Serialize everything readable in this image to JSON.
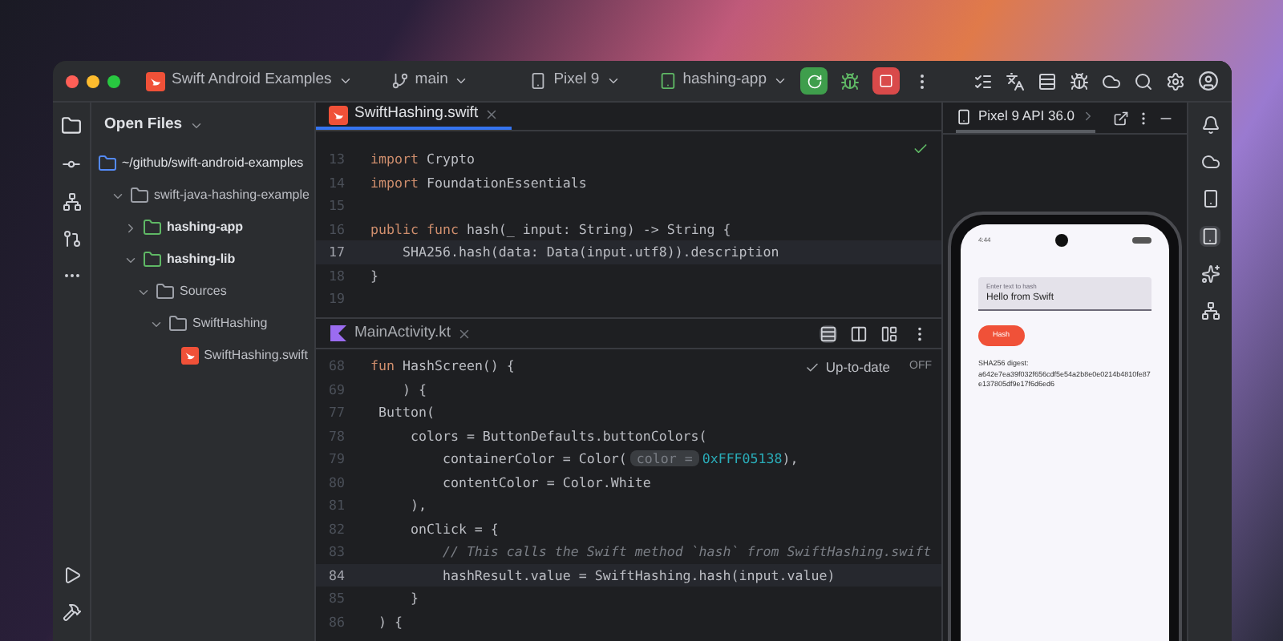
{
  "title_bar": {
    "project": "Swift Android Examples",
    "branch": "main",
    "device": "Pixel 9",
    "run_config": "hashing-app"
  },
  "project_panel": {
    "title": "Open Files",
    "tree": [
      {
        "label": "~/github/swift-android-examples",
        "kind": "root",
        "children": [
          {
            "label": "swift-java-hashing-example",
            "kind": "folder",
            "expanded": true,
            "children": [
              {
                "label": "hashing-app",
                "kind": "module",
                "expanded": false
              },
              {
                "label": "hashing-lib",
                "kind": "module",
                "expanded": true,
                "children": [
                  {
                    "label": "Sources",
                    "kind": "folder",
                    "expanded": true,
                    "children": [
                      {
                        "label": "SwiftHashing",
                        "kind": "folder",
                        "expanded": true,
                        "children": [
                          {
                            "label": "SwiftHashing.swift",
                            "kind": "swift"
                          }
                        ]
                      }
                    ]
                  }
                ]
              }
            ]
          }
        ]
      }
    ]
  },
  "editor_top": {
    "tabs": [
      {
        "label": "SwiftHashing.swift",
        "kind": "swift",
        "selected": true
      }
    ],
    "lines": [
      {
        "number": "13",
        "highlighted": false,
        "segments": [
          {
            "kind": "keyword",
            "text": "import "
          },
          {
            "kind": "plain",
            "text": "Crypto"
          }
        ]
      },
      {
        "number": "14",
        "highlighted": false,
        "segments": [
          {
            "kind": "keyword",
            "text": "import "
          },
          {
            "kind": "plain",
            "text": "FoundationEssentials"
          }
        ]
      },
      {
        "number": "15",
        "highlighted": false
      },
      {
        "number": "16",
        "highlighted": false,
        "segments": [
          {
            "kind": "keyword",
            "text": "public func "
          },
          {
            "kind": "plain",
            "text": "hash(_ input: String) -> String {"
          }
        ]
      },
      {
        "number": "17",
        "highlighted": true,
        "segments": [
          {
            "kind": "plain",
            "text": "    SHA256.hash(data: Data(input.utf8)).description"
          }
        ]
      },
      {
        "number": "18",
        "highlighted": false,
        "segments": [
          {
            "kind": "plain",
            "text": "}"
          }
        ]
      },
      {
        "number": "19",
        "highlighted": false
      }
    ]
  },
  "editor_bottom": {
    "tabs": [
      {
        "label": "MainActivity.kt",
        "kind": "kotlin",
        "selected": false
      }
    ],
    "status": "Up-to-date",
    "toggle": "OFF",
    "lines": [
      {
        "number": "68",
        "highlighted": false,
        "segments": [
          {
            "kind": "keyword",
            "text": "fun "
          },
          {
            "kind": "plain",
            "text": "HashScreen() {"
          }
        ]
      },
      {
        "number": "69",
        "highlighted": false,
        "segments": [
          {
            "kind": "plain",
            "text": "    ) {"
          }
        ]
      },
      {
        "number": "77",
        "highlighted": false,
        "segments": [
          {
            "kind": "plain",
            "text": " Button("
          }
        ]
      },
      {
        "number": "78",
        "highlighted": false,
        "segments": [
          {
            "kind": "plain",
            "text": "     colors = ButtonDefaults.buttonColors("
          }
        ]
      },
      {
        "number": "79",
        "highlighted": false,
        "segments": [
          {
            "kind": "plain",
            "text": "         containerColor = Color("
          },
          {
            "kind": "hint",
            "text": "color ="
          },
          {
            "kind": "number",
            "text": "0xFFF05138"
          },
          {
            "kind": "plain",
            "text": "),"
          }
        ]
      },
      {
        "number": "80",
        "highlighted": false,
        "segments": [
          {
            "kind": "plain",
            "text": "         contentColor = Color.White"
          }
        ]
      },
      {
        "number": "81",
        "highlighted": false,
        "segments": [
          {
            "kind": "plain",
            "text": "     ),"
          }
        ]
      },
      {
        "number": "82",
        "highlighted": false,
        "segments": [
          {
            "kind": "plain",
            "text": "     onClick = {"
          }
        ]
      },
      {
        "number": "83",
        "highlighted": false,
        "segments": [
          {
            "kind": "comment",
            "text": "         // This calls the Swift method `hash` from SwiftHashing.swift"
          }
        ]
      },
      {
        "number": "84",
        "highlighted": true,
        "segments": [
          {
            "kind": "plain",
            "text": "         hashResult.value = SwiftHashing.hash(input.value)"
          }
        ]
      },
      {
        "number": "85",
        "highlighted": false,
        "segments": [
          {
            "kind": "plain",
            "text": "     }"
          }
        ]
      },
      {
        "number": "86",
        "highlighted": false,
        "segments": [
          {
            "kind": "plain",
            "text": " ) {"
          }
        ]
      }
    ]
  },
  "device_panel": {
    "tab": "Pixel 9 API 36.0",
    "phone": {
      "time": "4:44",
      "field_label": "Enter text to hash",
      "field_value": "Hello from Swift",
      "button": "Hash",
      "result_label": "SHA256 digest:",
      "result_value": "a642e7ea39f032f656cdf5e54a2b8e0e0214b4810fe87e137805df9e17f6d6ed6"
    }
  }
}
